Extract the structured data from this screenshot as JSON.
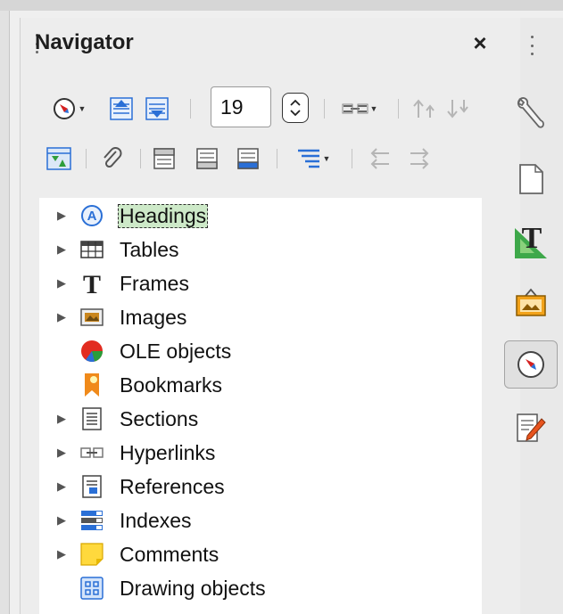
{
  "navigator": {
    "title": "Navigator",
    "close_glyph": "×",
    "page_number": "19",
    "toolbar_row1": [
      "navigate-by-icon",
      "previous-object-icon",
      "next-object-icon",
      "page-number-spinner",
      "drag-mode-icon",
      "promote-chapter-icon",
      "demote-chapter-icon"
    ],
    "toolbar_row2": [
      "toggle-master-view-icon",
      "set-reminder-icon",
      "header-icon",
      "footer-icon",
      "anchor-endnote-icon",
      "heading-levels-icon",
      "promote-level-icon",
      "demote-level-icon"
    ]
  },
  "tree": {
    "items": [
      {
        "label": "Headings",
        "icon": "headings-icon",
        "expandable": true,
        "selected": true
      },
      {
        "label": "Tables",
        "icon": "tables-icon",
        "expandable": true,
        "selected": false
      },
      {
        "label": "Frames",
        "icon": "frames-icon",
        "expandable": true,
        "selected": false
      },
      {
        "label": "Images",
        "icon": "images-icon",
        "expandable": true,
        "selected": false
      },
      {
        "label": "OLE objects",
        "icon": "ole-objects-icon",
        "expandable": false,
        "selected": false
      },
      {
        "label": "Bookmarks",
        "icon": "bookmarks-icon",
        "expandable": false,
        "selected": false
      },
      {
        "label": "Sections",
        "icon": "sections-icon",
        "expandable": true,
        "selected": false
      },
      {
        "label": "Hyperlinks",
        "icon": "hyperlinks-icon",
        "expandable": true,
        "selected": false
      },
      {
        "label": "References",
        "icon": "references-icon",
        "expandable": true,
        "selected": false
      },
      {
        "label": "Indexes",
        "icon": "indexes-icon",
        "expandable": true,
        "selected": false
      },
      {
        "label": "Comments",
        "icon": "comments-icon",
        "expandable": true,
        "selected": false
      },
      {
        "label": "Drawing objects",
        "icon": "drawing-objects-icon",
        "expandable": false,
        "selected": false
      }
    ]
  },
  "sidebar": {
    "items": [
      {
        "name": "properties-icon",
        "active": false
      },
      {
        "name": "page-icon",
        "active": false
      },
      {
        "name": "styles-icon",
        "active": false
      },
      {
        "name": "gallery-icon",
        "active": false
      },
      {
        "name": "navigator-icon",
        "active": true
      },
      {
        "name": "manage-changes-icon",
        "active": false
      }
    ]
  },
  "colors": {
    "selection_bg": "#cde9c8",
    "accent_blue": "#2a6fd6",
    "panel_bg": "#ededed"
  }
}
